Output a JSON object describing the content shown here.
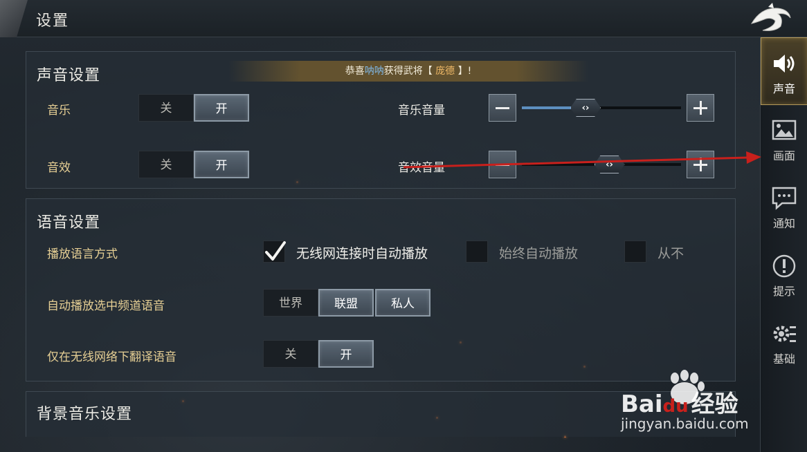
{
  "header": {
    "title": "设置"
  },
  "banner": {
    "prefix": "恭喜",
    "player": "呐呐",
    "middle": "获得武将【",
    "general": "庞德",
    "suffix": "】!"
  },
  "sound": {
    "title": "声音设置",
    "music": {
      "label": "音乐",
      "off": "关",
      "on": "开",
      "selected": "开"
    },
    "sfx": {
      "label": "音效",
      "off": "关",
      "on": "开",
      "selected": "开"
    },
    "music_volume": {
      "label": "音乐音量",
      "value": 0.4
    },
    "sfx_volume": {
      "label": "音效音量",
      "value": 0.55
    }
  },
  "voice": {
    "title": "语音设置",
    "play_mode": {
      "label": "播放语言方式",
      "options": [
        {
          "label": "无线网连接时自动播放",
          "checked": true
        },
        {
          "label": "始终自动播放",
          "checked": false
        },
        {
          "label": "从不",
          "checked": false
        }
      ]
    },
    "auto_channel": {
      "label": "自动播放选中频道语音",
      "options": [
        {
          "label": "世界",
          "on": false
        },
        {
          "label": "联盟",
          "on": true
        },
        {
          "label": "私人",
          "on": true
        }
      ]
    },
    "translate_wifi": {
      "label": "仅在无线网络下翻译语音",
      "off": "关",
      "on": "开",
      "selected": "开"
    }
  },
  "bgm": {
    "title": "背景音乐设置"
  },
  "nav": {
    "items": [
      {
        "label": "声音",
        "icon": "speaker-icon",
        "active": true
      },
      {
        "label": "画面",
        "icon": "picture-icon",
        "active": false
      },
      {
        "label": "通知",
        "icon": "chat-icon",
        "active": false
      },
      {
        "label": "提示",
        "icon": "exclamation-icon",
        "active": false
      },
      {
        "label": "基础",
        "icon": "gear-icon",
        "active": false
      }
    ]
  },
  "watermark": {
    "brand_bai": "Bai",
    "brand_du": "du",
    "brand_cn": "经验",
    "url": "jingyan.baidu.com"
  },
  "colors": {
    "gold_label": "#e6cf94",
    "annotation_arrow": "#c8201c",
    "accent_blue": "#5d8fc0"
  }
}
